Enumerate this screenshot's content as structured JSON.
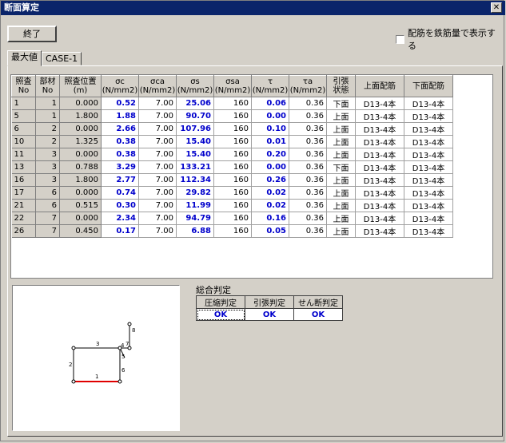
{
  "window": {
    "title": "断面算定"
  },
  "toolbar": {
    "close_label": "終了"
  },
  "options": {
    "show_as_rebar_label": "配筋を鉄筋量で表示する"
  },
  "tabs": [
    {
      "label": "最大値"
    },
    {
      "label": "CASE-1"
    }
  ],
  "table": {
    "headers": [
      "照査\nNo",
      "部材\nNo",
      "照査位置\n(m)",
      "σc\n(N/mm2)",
      "σca\n(N/mm2)",
      "σs\n(N/mm2)",
      "σsa\n(N/mm2)",
      "τ\n(N/mm2)",
      "τa\n(N/mm2)",
      "引張\n状態",
      "上面配筋",
      "下面配筋"
    ],
    "rows": [
      [
        "1",
        "1",
        "0.000",
        "0.52",
        "7.00",
        "25.06",
        "160",
        "0.06",
        "0.36",
        "下面",
        "D13-4本",
        "D13-4本"
      ],
      [
        "5",
        "1",
        "1.800",
        "1.88",
        "7.00",
        "90.70",
        "160",
        "0.00",
        "0.36",
        "上面",
        "D13-4本",
        "D13-4本"
      ],
      [
        "6",
        "2",
        "0.000",
        "2.66",
        "7.00",
        "107.96",
        "160",
        "0.10",
        "0.36",
        "上面",
        "D13-4本",
        "D13-4本"
      ],
      [
        "10",
        "2",
        "1.325",
        "0.38",
        "7.00",
        "15.40",
        "160",
        "0.01",
        "0.36",
        "上面",
        "D13-4本",
        "D13-4本"
      ],
      [
        "11",
        "3",
        "0.000",
        "0.38",
        "7.00",
        "15.40",
        "160",
        "0.20",
        "0.36",
        "上面",
        "D13-4本",
        "D13-4本"
      ],
      [
        "13",
        "3",
        "0.788",
        "3.29",
        "7.00",
        "133.21",
        "160",
        "0.00",
        "0.36",
        "下面",
        "D13-4本",
        "D13-4本"
      ],
      [
        "16",
        "3",
        "1.800",
        "2.77",
        "7.00",
        "112.34",
        "160",
        "0.26",
        "0.36",
        "上面",
        "D13-4本",
        "D13-4本"
      ],
      [
        "17",
        "6",
        "0.000",
        "0.74",
        "7.00",
        "29.82",
        "160",
        "0.02",
        "0.36",
        "上面",
        "D13-4本",
        "D13-4本"
      ],
      [
        "21",
        "6",
        "0.515",
        "0.30",
        "7.00",
        "11.99",
        "160",
        "0.02",
        "0.36",
        "上面",
        "D13-4本",
        "D13-4本"
      ],
      [
        "22",
        "7",
        "0.000",
        "2.34",
        "7.00",
        "94.79",
        "160",
        "0.16",
        "0.36",
        "上面",
        "D13-4本",
        "D13-4本"
      ],
      [
        "26",
        "7",
        "0.450",
        "0.17",
        "7.00",
        "6.88",
        "160",
        "0.05",
        "0.36",
        "上面",
        "D13-4本",
        "D13-4本"
      ]
    ]
  },
  "diagram": {
    "member_labels": [
      "1",
      "2",
      "3",
      "4",
      "5",
      "6",
      "7",
      "8"
    ]
  },
  "judgement": {
    "title": "総合判定",
    "headers": [
      "圧縮判定",
      "引張判定",
      "せん断判定"
    ],
    "values": [
      "OK",
      "OK",
      "OK"
    ]
  },
  "colors": {
    "highlight_member": "#e00000",
    "value_blue": "#0000cc"
  }
}
